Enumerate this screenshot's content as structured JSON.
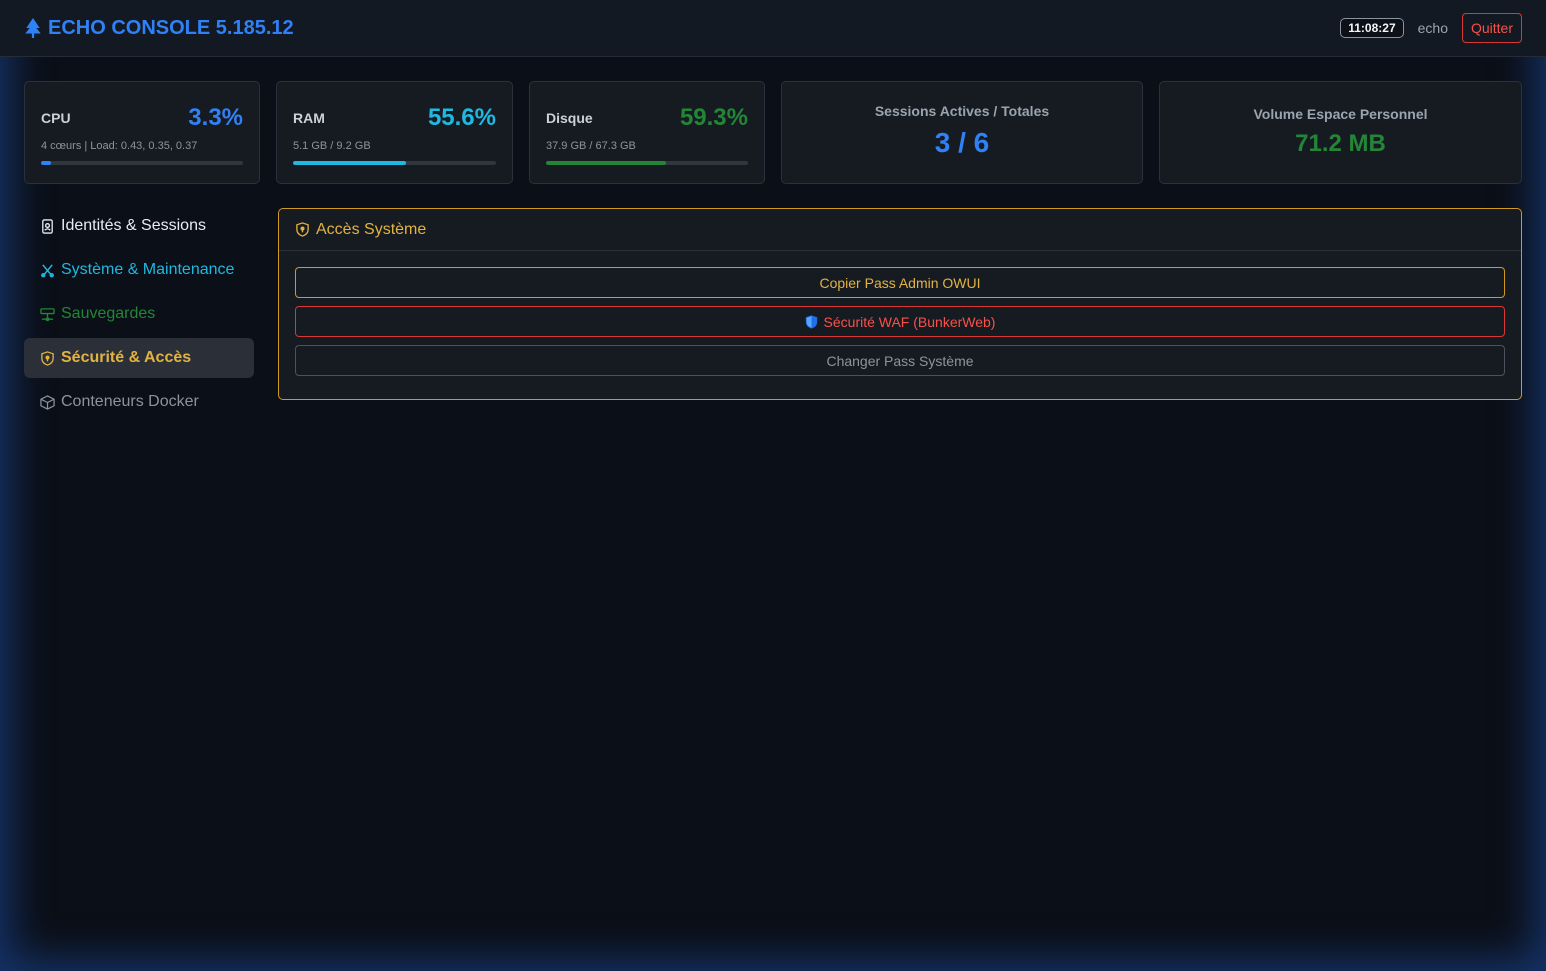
{
  "app": {
    "title": "ECHO CONSOLE 5.185.12",
    "time": "11:08:27",
    "user": "echo",
    "quit_label": "Quitter"
  },
  "colors": {
    "accent": "#2f81f7",
    "cyan": "#1fb8e0",
    "green": "#238636",
    "warning": "#d29922",
    "danger": "#f85149",
    "muted": "#8b949e"
  },
  "stats": {
    "cpu": {
      "label": "CPU",
      "value": "3.3%",
      "sub": "4 cœurs | Load: 0.43, 0.35, 0.37",
      "percent": 3.3
    },
    "ram": {
      "label": "RAM",
      "value": "55.6%",
      "sub": "5.1 GB / 9.2 GB",
      "percent": 55.6
    },
    "disk": {
      "label": "Disque",
      "value": "59.3%",
      "sub": "37.9 GB / 67.3 GB",
      "percent": 59.3
    },
    "sessions": {
      "label": "Sessions Actives / Totales",
      "value": "3 / 6"
    },
    "volume": {
      "label": "Volume Espace Personnel",
      "value": "71.2 MB"
    }
  },
  "sidebar": {
    "items": [
      {
        "label": "Identités & Sessions",
        "icon": "id-badge-icon"
      },
      {
        "label": "Système & Maintenance",
        "icon": "tools-icon"
      },
      {
        "label": "Sauvegardes",
        "icon": "hdd-network-icon"
      },
      {
        "label": "Sécurité & Accès",
        "icon": "shield-lock-icon",
        "active": true
      },
      {
        "label": "Conteneurs Docker",
        "icon": "box-icon"
      }
    ]
  },
  "panel": {
    "title": "Accès Système",
    "actions": [
      {
        "label": "Copier Pass Admin OWUI"
      },
      {
        "label": "Sécurité WAF (BunkerWeb)"
      },
      {
        "label": "Changer Pass Système"
      }
    ]
  }
}
